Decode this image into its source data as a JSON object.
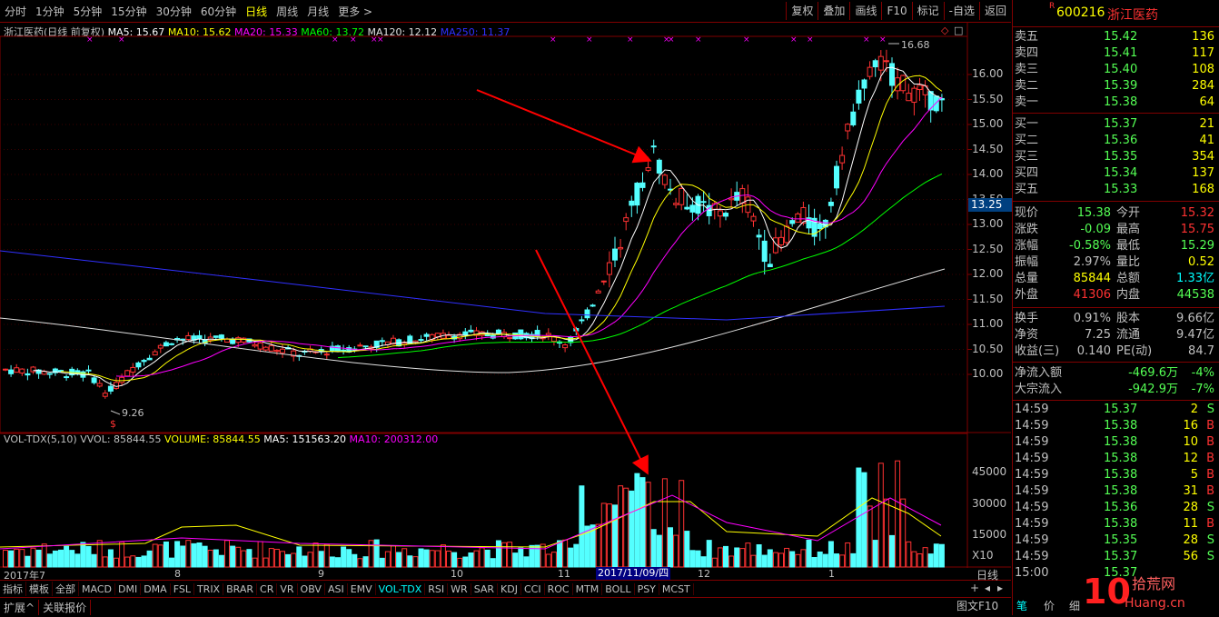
{
  "toolbar": {
    "periods": [
      "分时",
      "1分钟",
      "5分钟",
      "15分钟",
      "30分钟",
      "60分钟",
      "日线",
      "周线",
      "月线",
      "更多 >"
    ],
    "active_period": "日线",
    "buttons": [
      "复权",
      "叠加",
      "画线",
      "F10",
      "标记",
      "-自选",
      "返回"
    ]
  },
  "indicator_line": {
    "name": "浙江医药(日线 前复权)",
    "ma5": "MA5: 15.67",
    "ma10": "MA10: 15.62",
    "ma20": "MA20: 15.33",
    "ma60": "MA60: 13.72",
    "ma120": "MA120: 12.12",
    "ma250": "MA250: 11.37"
  },
  "price_labels": {
    "high": "16.68",
    "low": "9.26",
    "current": "13.25"
  },
  "price_axis": [
    "16.00",
    "15.50",
    "15.00",
    "14.50",
    "14.00",
    "13.50",
    "13.00",
    "12.50",
    "12.00",
    "11.50",
    "11.00",
    "10.50",
    "10.00"
  ],
  "volume_line": {
    "name": "VOL-TDX(5,10)",
    "vvol": "VVOL: 85844.55",
    "volume": "VOLUME: 85844.55",
    "ma5": "MA5: 151563.20",
    "ma10": "MA10: 200312.00"
  },
  "volume_axis": [
    "45000",
    "30000",
    "15000",
    "X10"
  ],
  "date_axis": {
    "labels": [
      "2017年7",
      "8",
      "9",
      "10",
      "11",
      "12",
      "1"
    ],
    "cursor_date": "2017/11/09/四"
  },
  "indicator_tabs": [
    "指标",
    "模板",
    "全部",
    "MACD",
    "DMI",
    "DMA",
    "FSL",
    "TRIX",
    "BRAR",
    "CR",
    "VR",
    "OBV",
    "ASI",
    "EMV",
    "VOL-TDX",
    "RSI",
    "WR",
    "SAR",
    "KDJ",
    "CCI",
    "ROC",
    "MTM",
    "BOLL",
    "PSY",
    "MCST"
  ],
  "active_tab": "VOL-TDX",
  "bottom_bar": {
    "expand": "扩展^",
    "related": "关联报价",
    "period_label": "日线"
  },
  "stock": {
    "code": "600216",
    "name": "浙江医药",
    "badge": "R"
  },
  "order_book": {
    "asks": [
      {
        "label": "卖五",
        "price": "15.42",
        "vol": "136"
      },
      {
        "label": "卖四",
        "price": "15.41",
        "vol": "117"
      },
      {
        "label": "卖三",
        "price": "15.40",
        "vol": "108"
      },
      {
        "label": "卖二",
        "price": "15.39",
        "vol": "284"
      },
      {
        "label": "卖一",
        "price": "15.38",
        "vol": "64"
      }
    ],
    "bids": [
      {
        "label": "买一",
        "price": "15.37",
        "vol": "21"
      },
      {
        "label": "买二",
        "price": "15.36",
        "vol": "41"
      },
      {
        "label": "买三",
        "price": "15.35",
        "vol": "354"
      },
      {
        "label": "买四",
        "price": "15.34",
        "vol": "137"
      },
      {
        "label": "买五",
        "price": "15.33",
        "vol": "168"
      }
    ]
  },
  "quote": [
    {
      "l1": "现价",
      "v1": "15.38",
      "l2": "今开",
      "v2": "15.32"
    },
    {
      "l1": "涨跌",
      "v1": "-0.09",
      "l2": "最高",
      "v2": "15.75"
    },
    {
      "l1": "涨幅",
      "v1": "-0.58%",
      "l2": "最低",
      "v2": "15.29"
    },
    {
      "l1": "振幅",
      "v1": "2.97%",
      "l2": "量比",
      "v2": "0.52"
    },
    {
      "l1": "总量",
      "v1": "85844",
      "l2": "总额",
      "v2": "1.33亿"
    },
    {
      "l1": "外盘",
      "v1": "41306",
      "l2": "内盘",
      "v2": "44538"
    }
  ],
  "fundamentals": [
    {
      "l1": "换手",
      "v1": "0.91%",
      "l2": "股本",
      "v2": "9.66亿"
    },
    {
      "l1": "净资",
      "v1": "7.25",
      "l2": "流通",
      "v2": "9.47亿"
    },
    {
      "l1": "收益(三)",
      "v1": "0.140",
      "l2": "PE(动)",
      "v2": "84.7"
    }
  ],
  "flows": [
    {
      "label": "净流入额",
      "value": "-469.6万",
      "pct": "-4%"
    },
    {
      "label": "大宗流入",
      "value": "-942.9万",
      "pct": "-7%"
    }
  ],
  "ticks": [
    {
      "t": "14:59",
      "p": "15.37",
      "v": "2",
      "s": "S"
    },
    {
      "t": "14:59",
      "p": "15.38",
      "v": "16",
      "s": "B"
    },
    {
      "t": "14:59",
      "p": "15.38",
      "v": "10",
      "s": "B"
    },
    {
      "t": "14:59",
      "p": "15.38",
      "v": "12",
      "s": "B"
    },
    {
      "t": "14:59",
      "p": "15.38",
      "v": "5",
      "s": "B"
    },
    {
      "t": "14:59",
      "p": "15.38",
      "v": "31",
      "s": "B"
    },
    {
      "t": "14:59",
      "p": "15.36",
      "v": "28",
      "s": "S"
    },
    {
      "t": "14:59",
      "p": "15.38",
      "v": "11",
      "s": "B"
    },
    {
      "t": "14:59",
      "p": "15.35",
      "v": "28",
      "s": "S"
    },
    {
      "t": "14:59",
      "p": "15.37",
      "v": "56",
      "s": "S"
    },
    {
      "t": "15:00",
      "p": "15.37",
      "v": "",
      "s": ""
    }
  ],
  "right_tabs": [
    "图文F10",
    "笔",
    "价",
    "细"
  ],
  "colors": {
    "up": "#ff3232",
    "down": "#54ffff",
    "ma5": "#ffffff",
    "ma10": "#ffff00",
    "ma20": "#ff00ff",
    "ma60": "#00ff00",
    "ma120": "#e0e0e0",
    "ma250": "#0000ff",
    "frame": "#800000",
    "arrow": "#ff0000"
  }
}
